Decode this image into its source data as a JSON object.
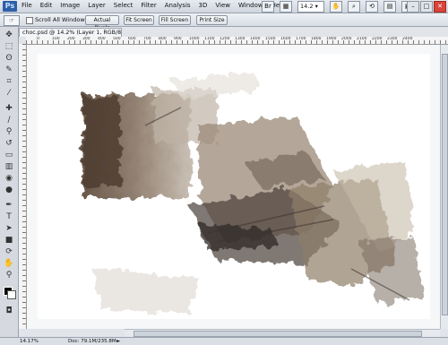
{
  "app": {
    "logo": "Ps"
  },
  "menu": [
    "File",
    "Edit",
    "Image",
    "Layer",
    "Select",
    "Filter",
    "Analysis",
    "3D",
    "View",
    "Window",
    "Help"
  ],
  "header_controls": {
    "zoom": "14.2",
    "zoom_arrow": "▾"
  },
  "window_buttons": {
    "minimize": "–",
    "maximize": "□",
    "close": "✕"
  },
  "options_bar": {
    "scroll_all_windows": "Scroll All Windows",
    "buttons": [
      "Actual Pixels",
      "Fit Screen",
      "Fill Screen",
      "Print Size"
    ]
  },
  "document": {
    "tab_title": "choc.psd @ 14.2% (Layer 1, RGB/8*)",
    "ruler_labels": [
      "0",
      "100",
      "200",
      "300",
      "400",
      "500",
      "600",
      "700",
      "800",
      "900",
      "1000",
      "1100",
      "1200",
      "1300",
      "1400",
      "1500",
      "1600",
      "1700",
      "1800",
      "1900",
      "2000",
      "2100",
      "2200",
      "2300",
      "2400"
    ]
  },
  "status": {
    "zoom": "14.17%",
    "doc": "Doc: 79.1M/235.8M",
    "arrow": "►"
  },
  "colors": {
    "foreground": "#000000",
    "background": "#ffffff",
    "accent": "#2c5fa8"
  }
}
